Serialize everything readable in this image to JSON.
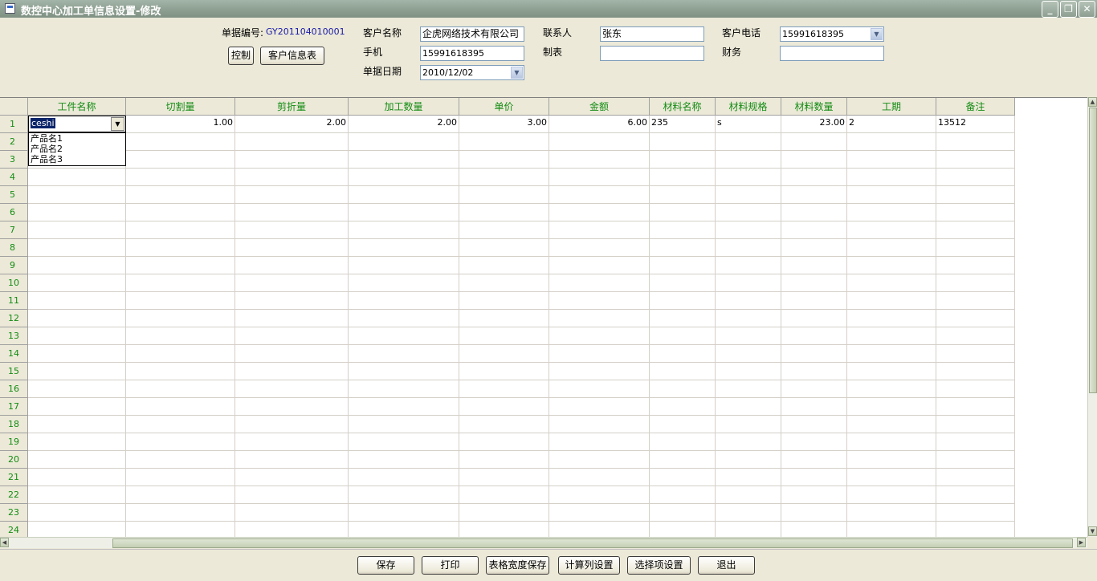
{
  "window": {
    "title": "数控中心加工单信息设置-修改",
    "minimize": "_",
    "restore": "❐",
    "close": "✕"
  },
  "form": {
    "doc_no_label": "单据编号:",
    "doc_no_value": "GY201104010001",
    "control_button": "控制",
    "customer_table_button": "客户信息表",
    "customer_name_label": "客户名称",
    "customer_name_value": "企虎网络技术有限公司",
    "mobile_label": "手机",
    "mobile_value": "15991618395",
    "doc_date_label": "单据日期",
    "doc_date_value": "2010/12/02",
    "contact_label": "联系人",
    "contact_value": "张东",
    "maker_label": "制表",
    "maker_value": "",
    "phone_label": "客户电话",
    "phone_value": "15991618395",
    "finance_label": "财务",
    "finance_value": ""
  },
  "grid": {
    "columns": [
      "工件名称",
      "切割量",
      "剪折量",
      "加工数量",
      "单价",
      "金额",
      "材料名称",
      "材料规格",
      "材料数量",
      "工期",
      "备注"
    ],
    "row_numbers": [
      "1",
      "2",
      "3",
      "4",
      "5",
      "6",
      "7",
      "8",
      "9",
      "10",
      "11",
      "12",
      "13",
      "14",
      "15",
      "16",
      "17",
      "18",
      "19",
      "20",
      "21",
      "22",
      "23",
      "24"
    ],
    "row1": {
      "part_name": "ceshi",
      "cut": "1.00",
      "fold": "2.00",
      "qty": "2.00",
      "price": "3.00",
      "amount": "6.00",
      "material": "235",
      "spec": "s",
      "material_qty": "23.00",
      "period": "2",
      "remark": "13512"
    },
    "dropdown_options": [
      "产品名1",
      "产品名2",
      "产品名3"
    ]
  },
  "buttons": [
    "保存",
    "打印",
    "表格宽度保存",
    "计算列设置",
    "选择项设置",
    "退出"
  ],
  "colors": {
    "header_text": "#138c13",
    "titlebar": "#8c9e90",
    "doc_no": "#1a1aa8"
  },
  "icons": [
    "app-icon",
    "minimize-icon",
    "restore-icon",
    "close-icon",
    "chevron-down-icon"
  ]
}
